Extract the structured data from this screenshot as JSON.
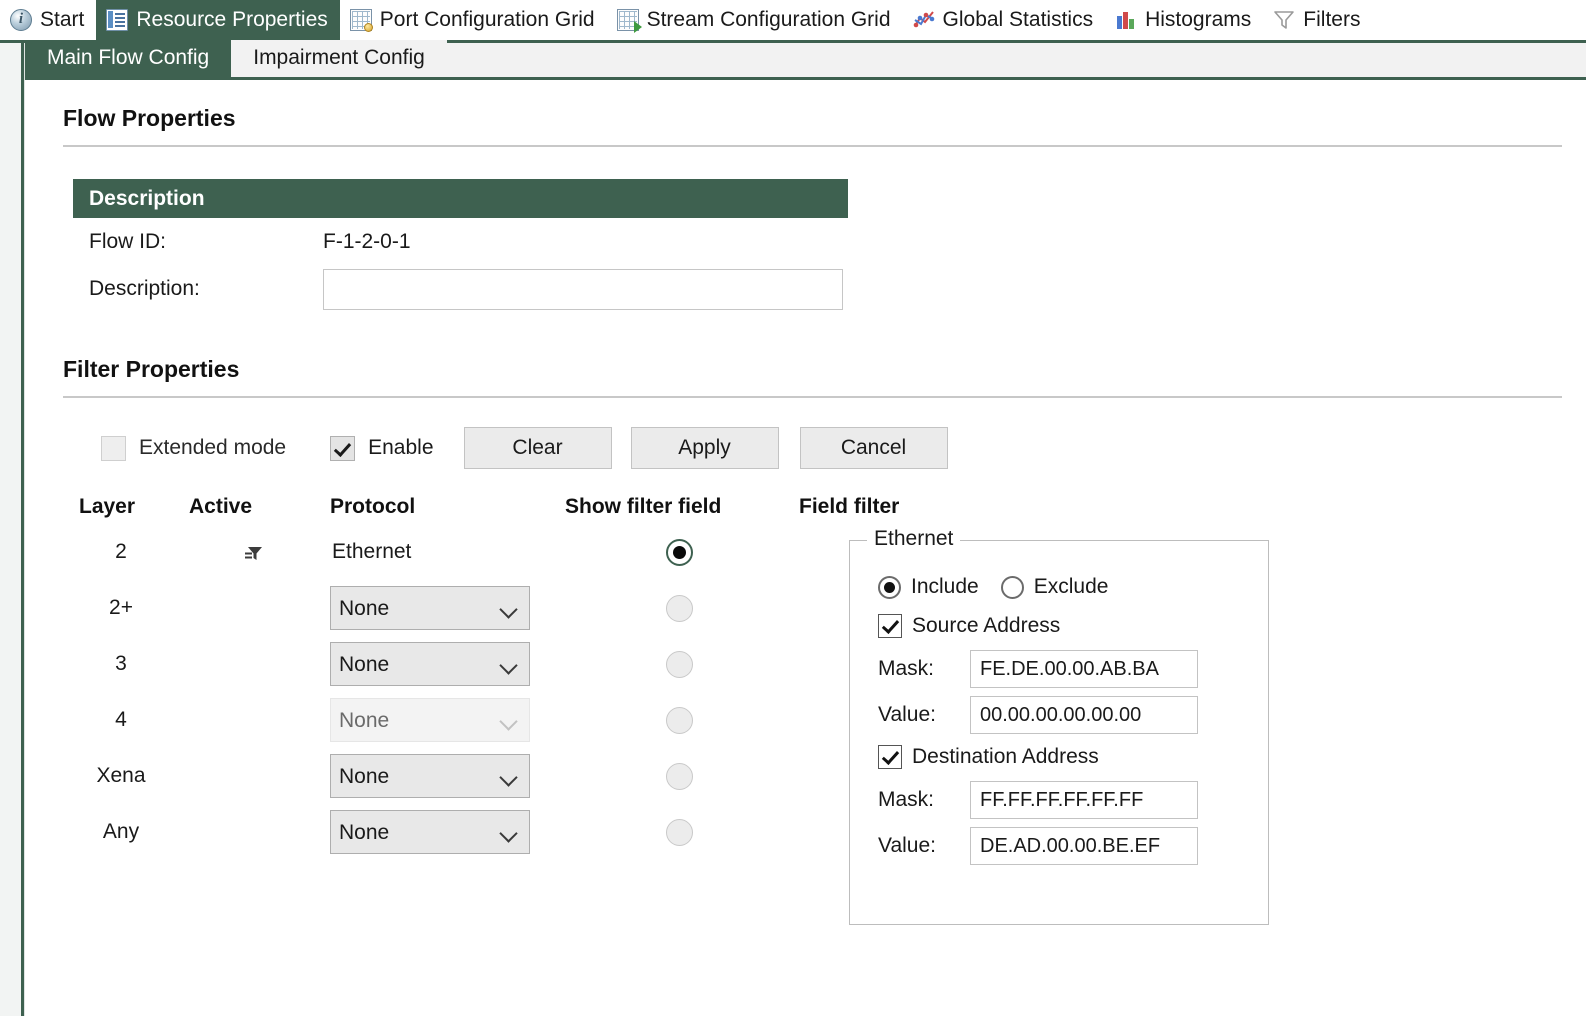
{
  "topnav": {
    "items": [
      {
        "label": "Start",
        "icon": "info-icon",
        "active": false
      },
      {
        "label": "Resource Properties",
        "icon": "resource-panel-icon",
        "active": true
      },
      {
        "label": "Port Configuration Grid",
        "icon": "grid-icon",
        "active": false
      },
      {
        "label": "Stream Configuration Grid",
        "icon": "stream-grid-icon",
        "active": false
      },
      {
        "label": "Global Statistics",
        "icon": "line-chart-icon",
        "active": false
      },
      {
        "label": "Histograms",
        "icon": "bar-chart-icon",
        "active": false
      },
      {
        "label": "Filters",
        "icon": "funnel-icon",
        "active": false
      }
    ]
  },
  "subtabs": [
    {
      "label": "Main Flow Config",
      "active": true
    },
    {
      "label": "Impairment Config",
      "active": false
    }
  ],
  "flow_properties": {
    "title": "Flow Properties",
    "description_header": "Description",
    "flow_id_label": "Flow ID:",
    "flow_id_value": "F-1-2-0-1",
    "description_label": "Description:",
    "description_value": "",
    "description_placeholder": ""
  },
  "filter_properties": {
    "title": "Filter Properties",
    "extended_mode_label": "Extended mode",
    "extended_mode_checked": false,
    "enable_label": "Enable",
    "enable_checked": true,
    "clear_label": "Clear",
    "apply_label": "Apply",
    "cancel_label": "Cancel",
    "columns": {
      "layer": "Layer",
      "active": "Active",
      "protocol": "Protocol",
      "show_filter_field": "Show filter field",
      "field_filter": "Field filter"
    },
    "rows": [
      {
        "layer": "2",
        "active_icon": "funnel-icon",
        "active": true,
        "protocol": "Ethernet",
        "protocol_is_select": false,
        "protocol_disabled": false,
        "selected": true
      },
      {
        "layer": "2+",
        "active_icon": "",
        "active": false,
        "protocol": "None",
        "protocol_is_select": true,
        "protocol_disabled": false,
        "selected": false
      },
      {
        "layer": "3",
        "active_icon": "",
        "active": false,
        "protocol": "None",
        "protocol_is_select": true,
        "protocol_disabled": false,
        "selected": false
      },
      {
        "layer": "4",
        "active_icon": "",
        "active": false,
        "protocol": "None",
        "protocol_is_select": true,
        "protocol_disabled": true,
        "selected": false
      },
      {
        "layer": "Xena",
        "active_icon": "",
        "active": false,
        "protocol": "None",
        "protocol_is_select": true,
        "protocol_disabled": false,
        "selected": false
      },
      {
        "layer": "Any",
        "active_icon": "",
        "active": false,
        "protocol": "None",
        "protocol_is_select": true,
        "protocol_disabled": false,
        "selected": false
      }
    ],
    "protocol_options": [
      "None"
    ]
  },
  "field_filter": {
    "legend": "Ethernet",
    "include_label": "Include",
    "exclude_label": "Exclude",
    "mode": "Include",
    "source_address_label": "Source Address",
    "source_address_checked": true,
    "source_mask_label": "Mask:",
    "source_mask_value": "FE.DE.00.00.AB.BA",
    "source_value_label": "Value:",
    "source_value_value": "00.00.00.00.00.00",
    "destination_address_label": "Destination Address",
    "destination_address_checked": true,
    "dest_mask_label": "Mask:",
    "dest_mask_value": "FF.FF.FF.FF.FF.FF",
    "dest_value_label": "Value:",
    "dest_value_value": "DE.AD.00.00.BE.EF"
  },
  "colors": {
    "accent_green": "#3e6150",
    "panel_bg": "#ffffff",
    "tabstrip_bg": "#f2f2f2"
  }
}
